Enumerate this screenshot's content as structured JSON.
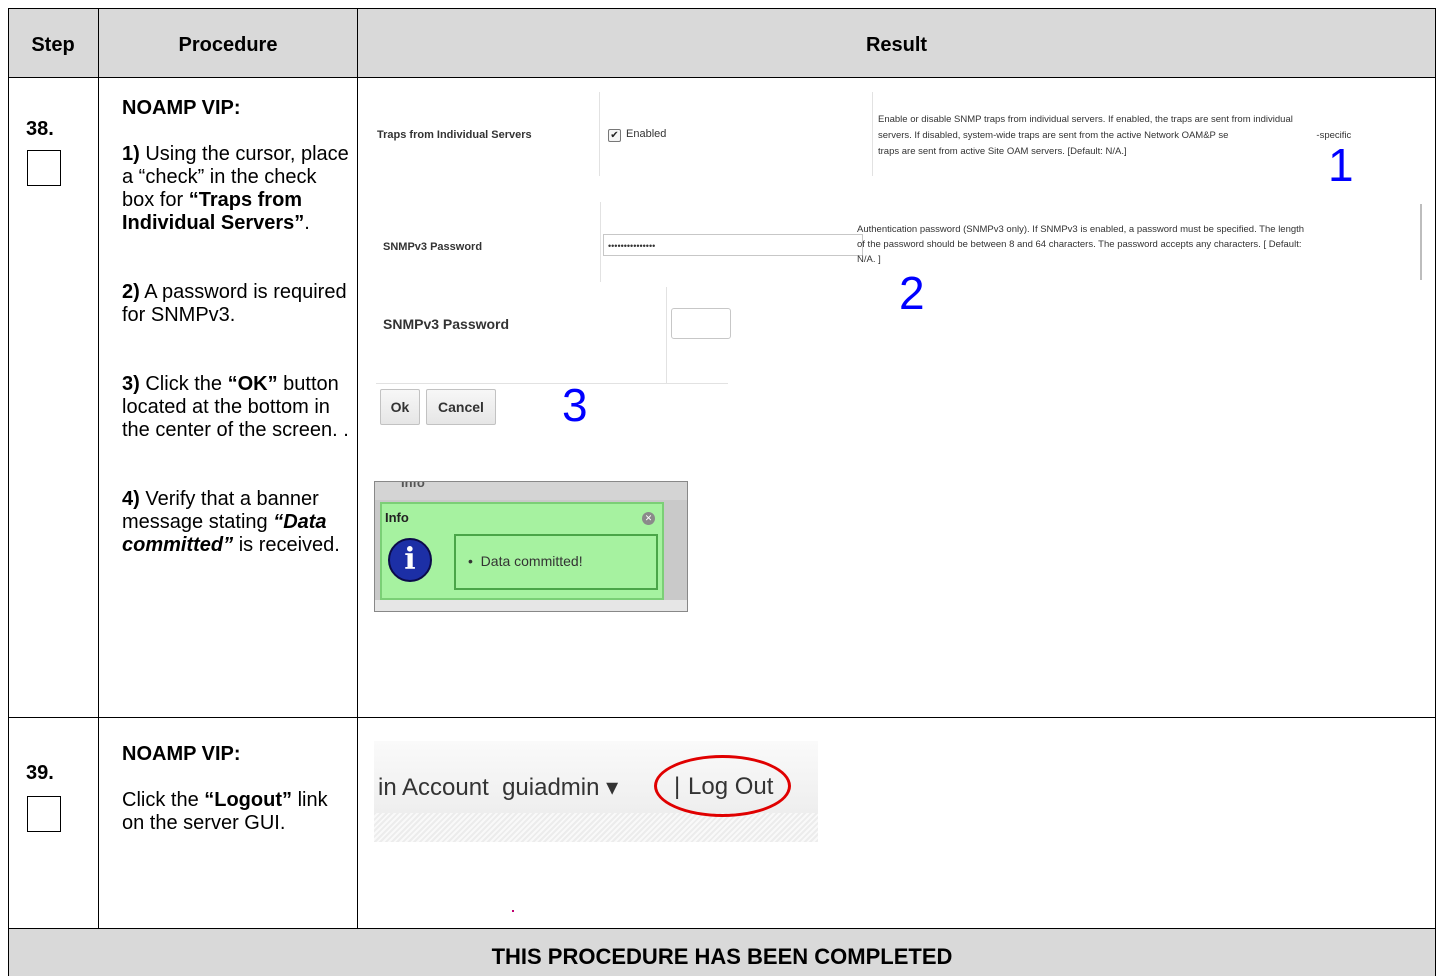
{
  "header": {
    "step": "Step",
    "procedure": "Procedure",
    "result": "Result"
  },
  "step38": {
    "number": "38.",
    "title": "NOAMP VIP:",
    "item1_num": "1)",
    "item1_pre": "Using the cursor, place a “check” in the check box for ",
    "item1_bold": "“Traps from Individual Servers”",
    "item1_post": ".",
    "item2_num": "2)",
    "item2_text": "A password is required for SNMPv3.",
    "item3_num": "3)",
    "item3_pre": "Click the ",
    "item3_bold": "“OK”",
    "item3_post": "button located at the bottom in the center of the screen. .",
    "item4_num": "4)",
    "item4_pre": "Verify that a banner message stating ",
    "item4_bold": "“Data committed”",
    "item4_post": "is received.",
    "screens": {
      "traps_label": "Traps from Individual Servers",
      "traps_value": "Enabled",
      "traps_desc_l1": "Enable or disable SNMP traps from individual servers. If enabled, the traps are sent from individual",
      "traps_desc_l2": "servers. If disabled, system-wide traps are sent from the active Network OAM&P se",
      "traps_desc_l2b": "-specific",
      "traps_desc_l3": "traps are sent from active Site OAM servers. [Default: N/A.]",
      "anno1": "1",
      "pw_label": "SNMPv3 Password",
      "pw_value": "•••••••••••••••",
      "pw_desc_l1": "Authentication password (SNMPv3 only). If SNMPv3 is enabled, a password must be specified. The length",
      "pw_desc_l2": "of the password should be between 8 and 64 characters. The password accepts any characters. [ Default:",
      "pw_desc_l3": "N/A. ]",
      "anno2": "2",
      "pw2_label": "SNMPv3 Password",
      "ok_label": "Ok",
      "cancel_label": "Cancel",
      "anno3": "3",
      "info_tab": "Info",
      "info_title": "Info",
      "info_message": "•  Data committed!"
    }
  },
  "step39": {
    "number": "39.",
    "title": "NOAMP VIP:",
    "text_pre": "Click the ",
    "text_bold": "“Logout”",
    "text_post": "link on the server GUI.",
    "screen": {
      "account_text": "in Account  guiadmin ▾",
      "separator": "|",
      "logout": "Log Out"
    }
  },
  "footer": {
    "completed": "THIS PROCEDURE HAS BEEN COMPLETED"
  },
  "colors": {
    "header_bg": "#d9d9d9",
    "annotation_blue": "#0000ff",
    "info_green": "#a6f2a0",
    "circle_red": "#e00000"
  }
}
